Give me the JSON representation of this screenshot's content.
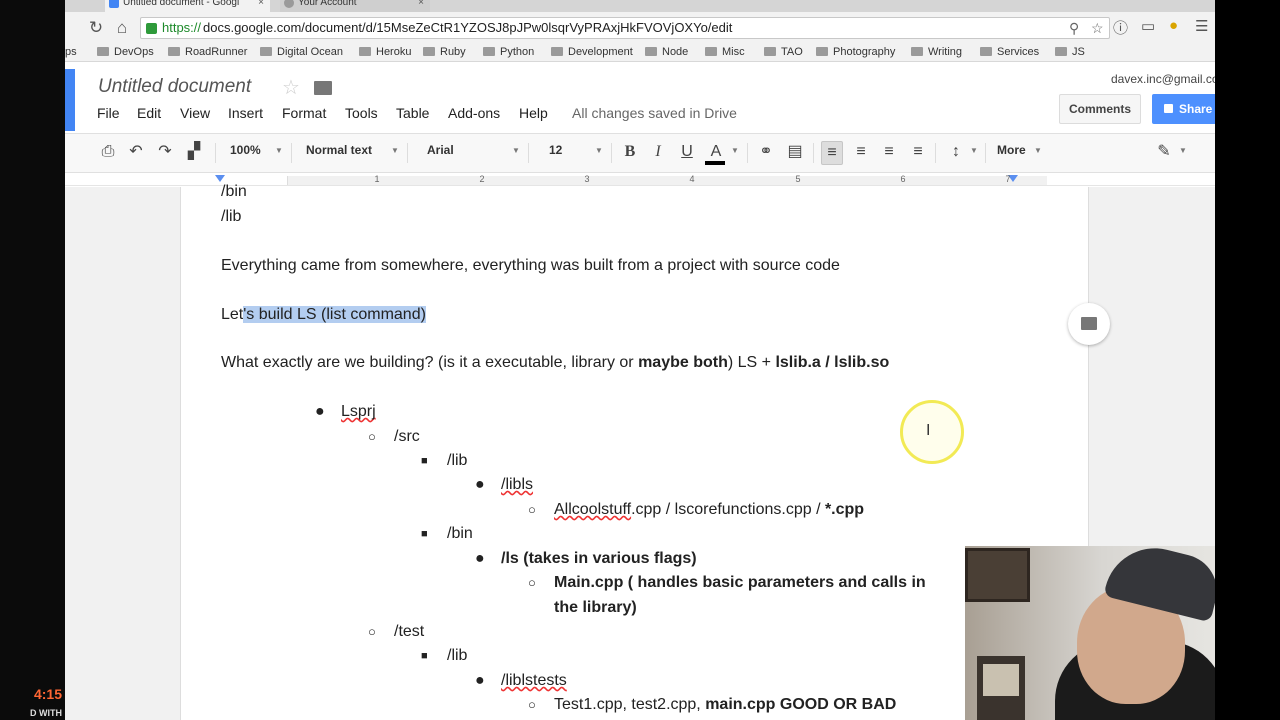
{
  "browser": {
    "tabs": [
      {
        "label": "Untitled document - Googl",
        "close": "×"
      },
      {
        "label": "Your Account",
        "close": "×"
      }
    ],
    "url_scheme": "https://",
    "url_rest": "docs.google.com/document/d/15MseZeCtR1YZOSJ8pJPw0lsqrVyPRAxjHkFVOVjOXYo/edit",
    "nav_icons": {
      "reload": "↻",
      "home": "⌂"
    },
    "bookmarks_prefix": "ps",
    "bookmarks": [
      "DevOps",
      "RoadRunner",
      "Digital Ocean",
      "Heroku",
      "Ruby",
      "Python",
      "Development",
      "Node",
      "Misc",
      "TAO",
      "Photography",
      "Writing",
      "Services",
      "JS"
    ]
  },
  "docs": {
    "title": "Untitled document",
    "user_email": "davex.inc@gmail.co",
    "comments_label": "Comments",
    "share_label": "Share",
    "menu": [
      "File",
      "Edit",
      "View",
      "Insert",
      "Format",
      "Tools",
      "Table",
      "Add-ons",
      "Help"
    ],
    "saved_status": "All changes saved in Drive",
    "accent_color": "#4285f4"
  },
  "toolbar": {
    "zoom": "100%",
    "style": "Normal text",
    "font": "Arial",
    "size": "12",
    "bold": "B",
    "italic": "I",
    "underline": "U",
    "text_color": "A",
    "more": "More"
  },
  "ruler": {
    "numbers": [
      "1",
      "2",
      "3",
      "4",
      "5",
      "6",
      "7"
    ]
  },
  "document": {
    "line_bin": "/bin",
    "line_lib": "/lib",
    "line_everything": "Everything came from somewhere, everything was built from a project with source code",
    "lets_prefix": "Let",
    "lets_selected": "'s build LS (list command)",
    "what_plain": "What exactly are we building? (is it a executable, library or ",
    "what_bold1": "maybe both",
    "what_plain2": ") LS + ",
    "what_bold2": "lslib.a / lslib.so",
    "tree": {
      "lsprj": "Lsprj",
      "src": "/src",
      "src_lib": "/lib",
      "libls": "/libls",
      "allcoolstuff": "Allcoolstuff",
      "cpp_files": ".cpp / lscorefunctions.cpp / ",
      "star_cpp": "*.cpp",
      "bin": "/bin",
      "ls": "/ls  (takes in various flags)",
      "main_cpp_1": "Main.cpp ( handles basic parameters and calls in",
      "main_cpp_2": "the library)",
      "test": "/test",
      "test_lib": "/lib",
      "liblstests": "/liblstests",
      "test_files": "Test1.cpp, test2.cpp, ",
      "test_bold": "main.cpp GOOD OR BAD"
    }
  },
  "overlay": {
    "time": "4:15",
    "with": "D WITH"
  }
}
